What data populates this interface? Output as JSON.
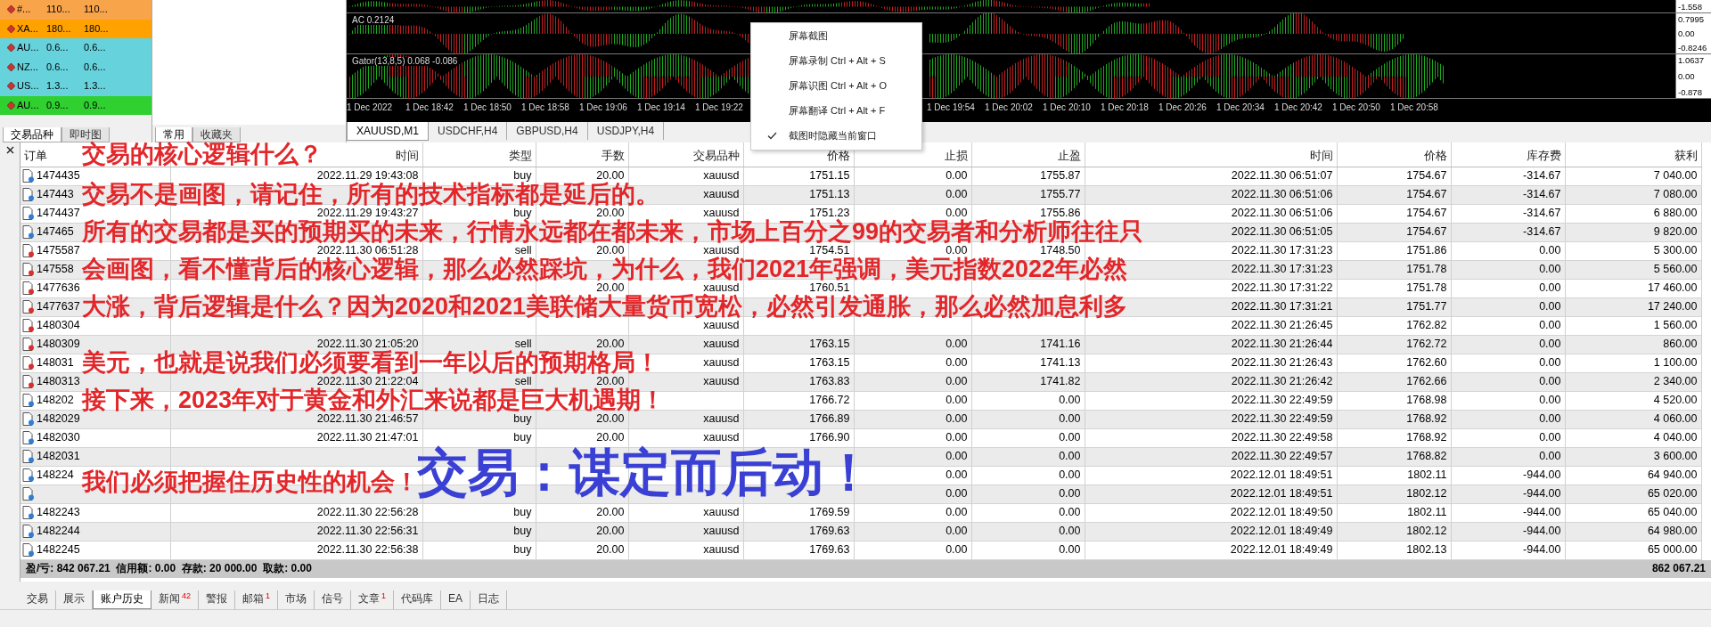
{
  "market_watch": {
    "rows": [
      {
        "symbol": "#...",
        "bid": "110...",
        "ask": "110...",
        "color": "#f7a44a"
      },
      {
        "symbol": "XA...",
        "bid": "180...",
        "ask": "180...",
        "color": "#ffa200"
      },
      {
        "symbol": "AU...",
        "bid": "0.6...",
        "ask": "0.6...",
        "color": "#66d2dc"
      },
      {
        "symbol": "NZ...",
        "bid": "0.6...",
        "ask": "0.6...",
        "color": "#66d2dc"
      },
      {
        "symbol": "US...",
        "bid": "1.3...",
        "ask": "1.3...",
        "color": "#66d2dc"
      },
      {
        "symbol": "AU...",
        "bid": "0.9...",
        "ask": "0.9...",
        "color": "#2fd02f"
      }
    ],
    "tabs": [
      {
        "label": "交易品种",
        "selected": true
      },
      {
        "label": "即时图",
        "selected": false
      }
    ]
  },
  "navigator": {
    "tabs": [
      {
        "label": "常用",
        "selected": true
      },
      {
        "label": "收藏夹",
        "selected": false
      }
    ]
  },
  "chart": {
    "panes": [
      {
        "axis": [
          "-1.558"
        ]
      },
      {
        "label": "AC 0.2124",
        "axis": [
          "0.7995",
          "0.00",
          "-0.8246"
        ]
      },
      {
        "label": "Gator(13,8,5) 0.068 -0.086",
        "axis": [
          "1.0637",
          "0.00",
          "-0.878"
        ]
      }
    ],
    "time_axis_left": [
      "1 Dec 2022",
      "1 Dec 18:42",
      "1 Dec 18:50",
      "1 Dec 18:58",
      "1 Dec 19:06",
      "1 Dec 19:14",
      "1 Dec 19:22"
    ],
    "time_axis_right": [
      "1 Dec 19:54",
      "1 Dec 20:02",
      "1 Dec 20:10",
      "1 Dec 20:18",
      "1 Dec 20:26",
      "1 Dec 20:34",
      "1 Dec 20:42",
      "1 Dec 20:50",
      "1 Dec 20:58"
    ],
    "tabs": [
      {
        "label": "XAUUSD,M1",
        "selected": true
      },
      {
        "label": "USDCHF,H4",
        "selected": false
      },
      {
        "label": "GBPUSD,H4",
        "selected": false
      },
      {
        "label": "USDJPY,H4",
        "selected": false
      }
    ]
  },
  "context_menu": {
    "items": [
      {
        "label": "屏幕截图",
        "checked": false
      },
      {
        "label": "屏幕录制",
        "shortcut": "Ctrl + Alt + S",
        "checked": false
      },
      {
        "label": "屏幕识图",
        "shortcut": "Ctrl + Alt + O",
        "checked": false
      },
      {
        "label": "屏幕翻译",
        "shortcut": "Ctrl + Alt + F",
        "checked": false
      },
      {
        "label": "截图时隐藏当前窗口",
        "checked": true
      }
    ]
  },
  "history_table": {
    "columns": [
      "订单",
      "时间",
      "类型",
      "手数",
      "交易品种",
      "价格",
      "止损",
      "止盈",
      "时间",
      "价格",
      "库存费",
      "获利"
    ],
    "rows": [
      {
        "kind": "buy",
        "cells": [
          "1474435",
          "2022.11.29 19:43:08",
          "buy",
          "20.00",
          "xauusd",
          "1751.15",
          "0.00",
          "1755.87",
          "2022.11.30 06:51:07",
          "1754.67",
          "-314.67",
          "7 040.00"
        ]
      },
      {
        "kind": "buy",
        "cells": [
          "147443",
          null,
          null,
          null,
          "xauusd",
          "1751.13",
          "0.00",
          "1755.77",
          "2022.11.30 06:51:06",
          "1754.67",
          "-314.67",
          "7 080.00"
        ]
      },
      {
        "kind": "buy",
        "cells": [
          "1474437",
          "2022.11.29 19:43:27",
          "buy",
          "20.00",
          "xauusd",
          "1751.23",
          "0.00",
          "1755.86",
          "2022.11.30 06:51:06",
          "1754.67",
          "-314.67",
          "6 880.00"
        ]
      },
      {
        "kind": "buy",
        "cells": [
          "147465",
          null,
          null,
          null,
          null,
          null,
          null,
          null,
          "2022.11.30 06:51:05",
          "1754.67",
          "-314.67",
          "9 820.00"
        ]
      },
      {
        "kind": "sell",
        "cells": [
          "1475587",
          "2022.11.30 06:51:28",
          "sell",
          "20.00",
          "xauusd",
          "1754.51",
          "0.00",
          "1748.50",
          "2022.11.30 17:31:23",
          "1751.86",
          "0.00",
          "5 300.00"
        ]
      },
      {
        "kind": "sell",
        "cells": [
          "147558",
          null,
          null,
          null,
          null,
          null,
          null,
          null,
          "2022.11.30 17:31:23",
          "1751.78",
          "0.00",
          "5 560.00"
        ]
      },
      {
        "kind": "sell",
        "cells": [
          "1477636",
          null,
          null,
          "20.00",
          "xauusd",
          "1760.51",
          null,
          null,
          "2022.11.30 17:31:22",
          "1751.78",
          "0.00",
          "17 460.00"
        ]
      },
      {
        "kind": "sell",
        "cells": [
          "1477637",
          null,
          null,
          null,
          null,
          null,
          null,
          null,
          "2022.11.30 17:31:21",
          "1751.77",
          "0.00",
          "17 240.00"
        ]
      },
      {
        "kind": "sell",
        "cells": [
          "1480304",
          null,
          null,
          null,
          "xauusd",
          null,
          null,
          null,
          "2022.11.30 21:26:45",
          "1762.82",
          "0.00",
          "1 560.00"
        ]
      },
      {
        "kind": "sell",
        "cells": [
          "1480309",
          "2022.11.30 21:05:20",
          "sell",
          "20.00",
          "xauusd",
          "1763.15",
          "0.00",
          "1741.16",
          "2022.11.30 21:26:44",
          "1762.72",
          "0.00",
          "860.00"
        ]
      },
      {
        "kind": "sell",
        "cells": [
          "148031",
          null,
          null,
          null,
          "xauusd",
          "1763.15",
          "0.00",
          "1741.13",
          "2022.11.30 21:26:43",
          "1762.60",
          "0.00",
          "1 100.00"
        ]
      },
      {
        "kind": "sell",
        "cells": [
          "1480313",
          "2022.11.30 21:22:04",
          "sell",
          "20.00",
          "xauusd",
          "1763.83",
          "0.00",
          "1741.82",
          "2022.11.30 21:26:42",
          "1762.66",
          "0.00",
          "2 340.00"
        ]
      },
      {
        "kind": "buy",
        "cells": [
          "148202",
          null,
          null,
          null,
          null,
          "1766.72",
          "0.00",
          "0.00",
          "2022.11.30 22:49:59",
          "1768.98",
          "0.00",
          "4 520.00"
        ]
      },
      {
        "kind": "buy",
        "cells": [
          "1482029",
          "2022.11.30 21:46:57",
          "buy",
          "20.00",
          "xauusd",
          "1766.89",
          "0.00",
          "0.00",
          "2022.11.30 22:49:59",
          "1768.92",
          "0.00",
          "4 060.00"
        ]
      },
      {
        "kind": "buy",
        "cells": [
          "1482030",
          "2022.11.30 21:47:01",
          "buy",
          "20.00",
          "xauusd",
          "1766.90",
          "0.00",
          "0.00",
          "2022.11.30 22:49:58",
          "1768.92",
          "0.00",
          "4 040.00"
        ]
      },
      {
        "kind": "buy",
        "cells": [
          "1482031",
          null,
          null,
          null,
          null,
          null,
          "0.00",
          "0.00",
          "2022.11.30 22:49:57",
          "1768.82",
          "0.00",
          "3 600.00"
        ]
      },
      {
        "kind": "buy",
        "cells": [
          "148224",
          null,
          null,
          null,
          null,
          null,
          "0.00",
          "0.00",
          "2022.12.01 18:49:51",
          "1802.11",
          "-944.00",
          "64 940.00"
        ]
      },
      {
        "kind": "buy",
        "cells": [
          null,
          null,
          null,
          null,
          null,
          null,
          "0.00",
          "0.00",
          "2022.12.01 18:49:51",
          "1802.12",
          "-944.00",
          "65 020.00"
        ]
      },
      {
        "kind": "buy",
        "cells": [
          "1482243",
          "2022.11.30 22:56:28",
          "buy",
          "20.00",
          "xauusd",
          "1769.59",
          "0.00",
          "0.00",
          "2022.12.01 18:49:50",
          "1802.11",
          "-944.00",
          "65 040.00"
        ]
      },
      {
        "kind": "buy",
        "cells": [
          "1482244",
          "2022.11.30 22:56:31",
          "buy",
          "20.00",
          "xauusd",
          "1769.63",
          "0.00",
          "0.00",
          "2022.12.01 18:49:49",
          "1802.12",
          "-944.00",
          "64 980.00"
        ]
      },
      {
        "kind": "buy",
        "cells": [
          "1482245",
          "2022.11.30 22:56:38",
          "buy",
          "20.00",
          "xauusd",
          "1769.63",
          "0.00",
          "0.00",
          "2022.12.01 18:49:49",
          "1802.13",
          "-944.00",
          "65 000.00"
        ]
      }
    ],
    "summary": {
      "text": "盈/亏: 842 067.21  信用额: 0.00  存款: 20 000.00  取款: 0.00",
      "total": "862 067.21"
    }
  },
  "terminal_tabs": [
    {
      "label": "交易",
      "selected": false
    },
    {
      "label": "展示",
      "selected": false
    },
    {
      "label": "账户历史",
      "selected": true
    },
    {
      "label": "新闻",
      "count": "42",
      "selected": false
    },
    {
      "label": "警报",
      "selected": false
    },
    {
      "label": "邮箱",
      "count": "1",
      "selected": false
    },
    {
      "label": "市场",
      "selected": false
    },
    {
      "label": "信号",
      "selected": false
    },
    {
      "label": "文章",
      "count": "1",
      "selected": false
    },
    {
      "label": "代码库",
      "selected": false
    },
    {
      "label": "EA",
      "selected": false
    },
    {
      "label": "日志",
      "selected": false
    }
  ],
  "overlay": {
    "notes": [
      "交易的核心逻辑什么？",
      "交易不是画图，请记住，所有的技术指标都是延后的。",
      "所有的交易都是买的预期买的未来，行情永远都在都未来，市场上百分之99的交易者和分析师往往只",
      "会画图，看不懂背后的核心逻辑，那么必然踩坑，为什么，我们2021年强调，美元指数2022年必然",
      "大涨，背后逻辑是什么？因为2020和2021美联储大量货币宽松，必然引发通胀，那么必然加息利多",
      "美元，也就是说我们必须要看到一年以后的预期格局！",
      "接下来，2023年对于黄金和外汇来说都是巨大机遇期！",
      "我们必须把握住历史性的机会！"
    ],
    "slogan": "交易：谋定而后动！"
  }
}
